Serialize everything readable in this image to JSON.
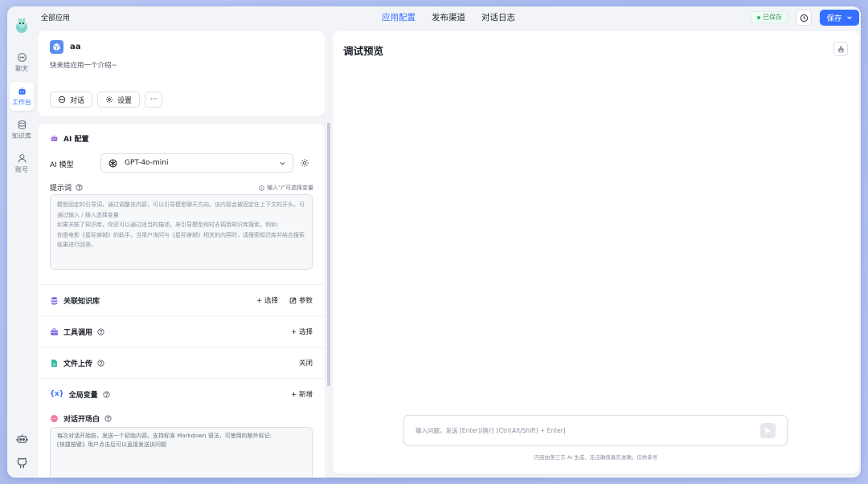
{
  "nav": {
    "items": [
      {
        "label": "聊天",
        "icon": "chat-icon"
      },
      {
        "label": "工作台",
        "icon": "robot-icon",
        "active": true
      },
      {
        "label": "知识库",
        "icon": "database-icon"
      },
      {
        "label": "账号",
        "icon": "user-icon"
      }
    ],
    "bottom": [
      "bot-icon",
      "github-icon"
    ]
  },
  "topbar": {
    "breadcrumb": "全部应用",
    "tabs": [
      {
        "label": "应用配置",
        "active": true
      },
      {
        "label": "发布渠道"
      },
      {
        "label": "对话日志"
      }
    ],
    "saved_status": "已保存",
    "save_label": "保存"
  },
  "app": {
    "name": "aa",
    "intro": "快来给应用一个介绍~",
    "chat_button": "对话",
    "settings_button": "设置",
    "more_button": "···"
  },
  "config": {
    "title": "AI 配置",
    "model_label": "AI 模型",
    "model_value": "GPT-4o-mini",
    "prompt_label": "提示词",
    "prompt_hint": "输入\"/\"可选择变量",
    "prompt_placeholder": "模型固定的引导词，通过调整该内容，可以引导模型聊天方向。该内容会被固定在上下文的开头。可通过输入 / 插入选择变量\n如果关联了知识库，你还可以通过适当的描述，来引导模型何时去调用知识库搜索。例如:\n你是电影《星际穿越》的助手，当用户询问与《星际穿越》相关的内容时，请搜索知识库并结合搜索结果进行回答。",
    "rows": {
      "kb": {
        "label": "关联知识库",
        "select": "+ 选择",
        "params": "参数"
      },
      "tools": {
        "label": "工具调用",
        "action": "+ 选择"
      },
      "upload": {
        "label": "文件上传",
        "action": "关闭"
      },
      "vars": {
        "label": "全局变量",
        "action": "+ 新增"
      }
    },
    "opening_title": "对话开场白",
    "opening_placeholder": "每次对话开始前，发送一个初始内容。支持标准 Markdown 语法，可使用的额外标记:\n[快捷按键]: 用户点击后可以直接发送该问题"
  },
  "preview": {
    "title": "调试预览",
    "input_placeholder": "输入问题，发送 [Enter]/换行 [Ctrl(Alt/Shift) + Enter]",
    "disclaimer": "内容由第三方 AI 生成，无法确保真实准确，仅供参考"
  },
  "colors": {
    "accent": "#3370ff",
    "saved": "#2e9b5a"
  }
}
